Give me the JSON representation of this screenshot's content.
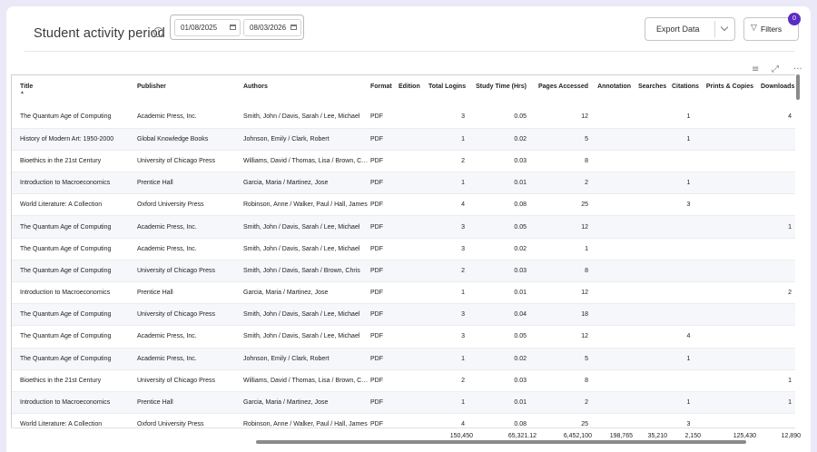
{
  "header": {
    "title": "Student activity period",
    "info_icon": "info-circle-icon",
    "date_start": "01/08/2025",
    "date_end": "08/03/2026",
    "export_label": "Export Data",
    "filters_label": "Filters",
    "filters_badge": "0"
  },
  "toolbar": {
    "filter_icon": "filter-lines-icon",
    "expand_icon": "expand-icon",
    "more_icon": "more-horizontal-icon"
  },
  "table": {
    "columns": [
      "Title",
      "Publisher",
      "Authors",
      "Format",
      "Edition",
      "Total Logins",
      "Study Time (Hrs)",
      "Pages Accessed",
      "Annotation",
      "Searches",
      "Citations",
      "Prints & Copies",
      "Downloads"
    ],
    "rows": [
      [
        "The Quantum Age of Computing",
        "Academic Press, Inc.",
        "Smith, John / Davis, Sarah / Lee, Michael",
        "PDF",
        "",
        "3",
        "0.05",
        "12",
        "",
        "",
        "1",
        "",
        "4"
      ],
      [
        "History of Modern Art: 1950-2000",
        "Global Knowledge Books",
        "Johnson, Emily / Clark, Robert",
        "PDF",
        "",
        "1",
        "0.02",
        "5",
        "",
        "",
        "1",
        "",
        ""
      ],
      [
        "Bioethics in the 21st Century",
        "University of Chicago Press",
        "Williams, David / Thomas, Lisa / Brown, Chris",
        "PDF",
        "",
        "2",
        "0.03",
        "8",
        "",
        "",
        "",
        "",
        ""
      ],
      [
        "Introduction to Macroeconomics",
        "Prentice Hall",
        "Garcia, Maria / Martinez, Jose",
        "PDF",
        "",
        "1",
        "0.01",
        "2",
        "",
        "",
        "1",
        "",
        ""
      ],
      [
        "World Literature: A Collection",
        "Oxford University Press",
        "Robinson, Anne / Walker, Paul / Hall, James",
        "PDF",
        "",
        "4",
        "0.08",
        "25",
        "",
        "",
        "3",
        "",
        ""
      ],
      [
        "The Quantum Age of Computing",
        "Academic Press, Inc.",
        "Smith, John / Davis, Sarah / Lee, Michael",
        "PDF",
        "",
        "3",
        "0.05",
        "12",
        "",
        "",
        "",
        "",
        "1"
      ],
      [
        "The Quantum Age of Computing",
        "Academic Press, Inc.",
        "Smith, John / Davis, Sarah / Lee, Michael",
        "PDF",
        "",
        "3",
        "0.02",
        "1",
        "",
        "",
        "",
        "",
        ""
      ],
      [
        "The Quantum Age of Computing",
        "University of Chicago Press",
        "Smith, John / Davis, Sarah / Brown, Chris",
        "PDF",
        "",
        "2",
        "0.03",
        "8",
        "",
        "",
        "",
        "",
        ""
      ],
      [
        "Introduction to Macroeconomics",
        "Prentice Hall",
        "Garcia, Maria / Martinez, Jose",
        "PDF",
        "",
        "1",
        "0.01",
        "12",
        "",
        "",
        "",
        "",
        "2"
      ],
      [
        "The Quantum Age of Computing",
        "University of Chicago Press",
        "Smith, John / Davis, Sarah / Lee, Michael",
        "PDF",
        "",
        "3",
        "0.04",
        "18",
        "",
        "",
        "",
        "",
        ""
      ],
      [
        "The Quantum Age of Computing",
        "Academic Press, Inc.",
        "Smith, John / Davis, Sarah / Lee, Michael",
        "PDF",
        "",
        "3",
        "0.05",
        "12",
        "",
        "",
        "4",
        "",
        ""
      ],
      [
        "The Quantum Age of Computing",
        "Academic Press, Inc.",
        "Johnson, Emily / Clark, Robert",
        "PDF",
        "",
        "1",
        "0.02",
        "5",
        "",
        "",
        "1",
        "",
        ""
      ],
      [
        "Bioethics in the 21st Century",
        "University of Chicago Press",
        "Williams, David / Thomas, Lisa / Brown, Chris",
        "PDF",
        "",
        "2",
        "0.03",
        "8",
        "",
        "",
        "",
        "",
        "1"
      ],
      [
        "Introduction to Macroeconomics",
        "Prentice Hall",
        "Garcia, Maria / Martinez, Jose",
        "PDF",
        "",
        "1",
        "0.01",
        "2",
        "",
        "",
        "1",
        "",
        "1"
      ],
      [
        "World Literature: A Collection",
        "Oxford University Press",
        "Robinson, Anne / Walker, Paul / Hall, James",
        "PDF",
        "",
        "4",
        "0.08",
        "25",
        "",
        "",
        "3",
        "",
        ""
      ]
    ],
    "totals": {
      "total_logins": "150,450",
      "study_time": "65,321.12",
      "pages_accessed": "6,452,100",
      "annotation": "198,765",
      "searches": "35,210",
      "citations": "2,150",
      "prints_copies": "125,430",
      "downloads": "12,890"
    }
  }
}
